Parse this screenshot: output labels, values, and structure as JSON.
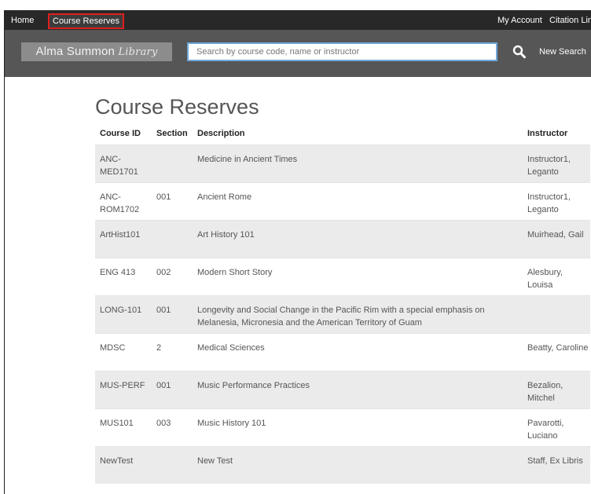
{
  "topnav": {
    "home": "Home",
    "course_reserves": "Course Reserves",
    "my_account": "My Account",
    "citation_linker": "Citation Link"
  },
  "banner": {
    "logo_main": "Alma Summon",
    "logo_sub": "Library",
    "search_placeholder": "Search by course code, name or instructor",
    "search_value": "",
    "new_search": "New Search"
  },
  "page": {
    "title": "Course Reserves"
  },
  "table": {
    "headers": {
      "course_id": "Course ID",
      "section": "Section",
      "description": "Description",
      "instructor": "Instructor"
    },
    "rows": [
      {
        "course_id": "ANC-MED1701",
        "section": "",
        "description": "Medicine in Ancient Times",
        "instructor": "Instructor1, Leganto"
      },
      {
        "course_id": "ANC-ROM1702",
        "section": "001",
        "description": "Ancient Rome",
        "instructor": "Instructor1, Leganto"
      },
      {
        "course_id": "ArtHist101",
        "section": "",
        "description": "Art History 101",
        "instructor": "Muirhead, Gail"
      },
      {
        "course_id": "ENG 413",
        "section": "002",
        "description": "Modern Short Story",
        "instructor": "Alesbury, Louisa"
      },
      {
        "course_id": "LONG-101",
        "section": "001",
        "description": "Longevity and Social Change in the Pacific Rim with a special emphasis on Melanesia, Micronesia and the American Territory of Guam",
        "instructor": ""
      },
      {
        "course_id": "MDSC",
        "section": "2",
        "description": "Medical Sciences",
        "instructor": "Beatty, Caroline"
      },
      {
        "course_id": "MUS-PERF",
        "section": "001",
        "description": "Music Performance Practices",
        "instructor": "Bezalion, Mitchel"
      },
      {
        "course_id": "MUS101",
        "section": "003",
        "description": "Music History 101",
        "instructor": "Pavarotti, Luciano"
      },
      {
        "course_id": "NewTest",
        "section": "",
        "description": "New Test",
        "instructor": "Staff, Ex Libris"
      }
    ]
  },
  "colors": {
    "topnav_bg": "#282828",
    "banner_bg": "#565656",
    "highlight_border": "#e01e1e",
    "search_border": "#6fa8dc",
    "row_alt": "#ebebeb"
  },
  "icons": {
    "search": "search-icon"
  }
}
